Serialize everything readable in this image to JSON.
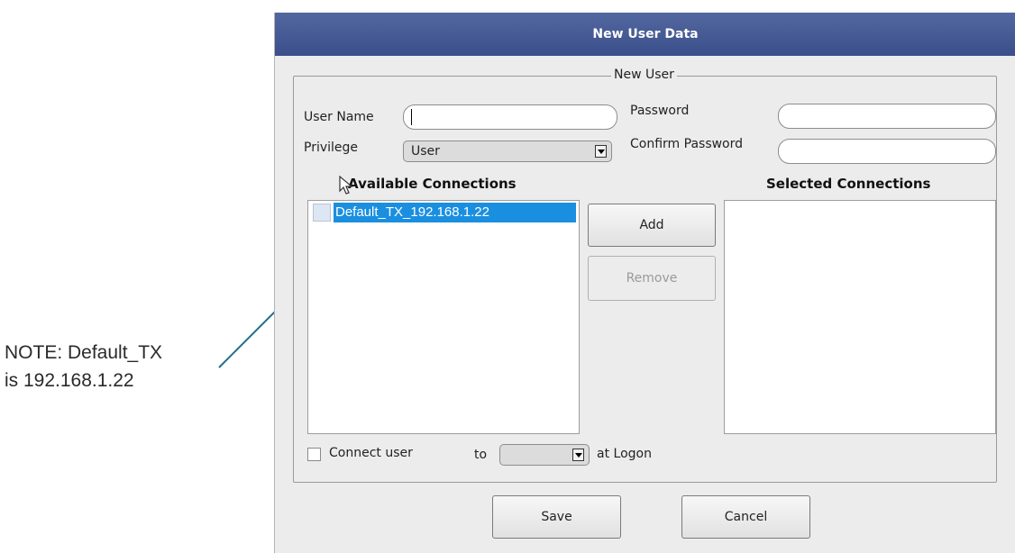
{
  "annotation": {
    "line1": "NOTE: Default_TX",
    "line2": "is 192.168.1.22"
  },
  "dialog": {
    "title": "New User Data",
    "group_title": "New User",
    "user_name": {
      "label": "User Name",
      "value": ""
    },
    "password": {
      "label": "Password",
      "value": ""
    },
    "privilege": {
      "label": "Privilege",
      "value": "User"
    },
    "confirm_password": {
      "label": "Confirm Password",
      "value": ""
    },
    "available": {
      "header": "Available Connections",
      "items": [
        {
          "label": "Default_TX_192.168.1.22",
          "checked": false,
          "selected": true
        }
      ]
    },
    "selected": {
      "header": "Selected Connections",
      "items": []
    },
    "add_label": "Add",
    "remove_label": "Remove",
    "connect": {
      "label": "Connect user",
      "to_label": "to",
      "to_value": "",
      "suffix": "at Logon",
      "checked": false
    },
    "save_label": "Save",
    "cancel_label": "Cancel"
  },
  "colors": {
    "titlebar": "#3f5590",
    "selection": "#1a8fe0",
    "annotation_line": "#1f6f8f"
  }
}
